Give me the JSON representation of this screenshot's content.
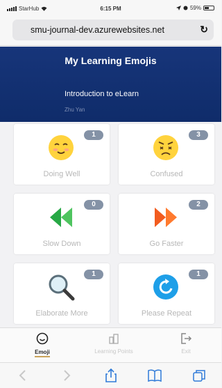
{
  "status_bar": {
    "carrier": "StarHub",
    "time": "6:15 PM",
    "battery": "59%"
  },
  "browser": {
    "url": "smu-journal-dev.azurewebsites.net"
  },
  "header": {
    "title": "My Learning Emojis",
    "course": "Introduction to eLearn",
    "user": "Zhu Yan"
  },
  "cards": [
    {
      "label": "Doing Well",
      "count": "1",
      "icon": "smiley-face-icon"
    },
    {
      "label": "Confused",
      "count": "3",
      "icon": "confused-face-icon"
    },
    {
      "label": "Slow Down",
      "count": "0",
      "icon": "rewind-icon"
    },
    {
      "label": "Go Faster",
      "count": "2",
      "icon": "fast-forward-icon"
    },
    {
      "label": "Elaborate More",
      "count": "1",
      "icon": "magnifier-icon"
    },
    {
      "label": "Please Repeat",
      "count": "1",
      "icon": "repeat-icon"
    }
  ],
  "tabs": [
    {
      "label": "Emoji",
      "active": true,
      "icon": "smiley-outline-icon"
    },
    {
      "label": "Learning Points",
      "active": false,
      "icon": "lightbulb-icon"
    },
    {
      "label": "Exit",
      "active": false,
      "icon": "exit-icon"
    }
  ]
}
